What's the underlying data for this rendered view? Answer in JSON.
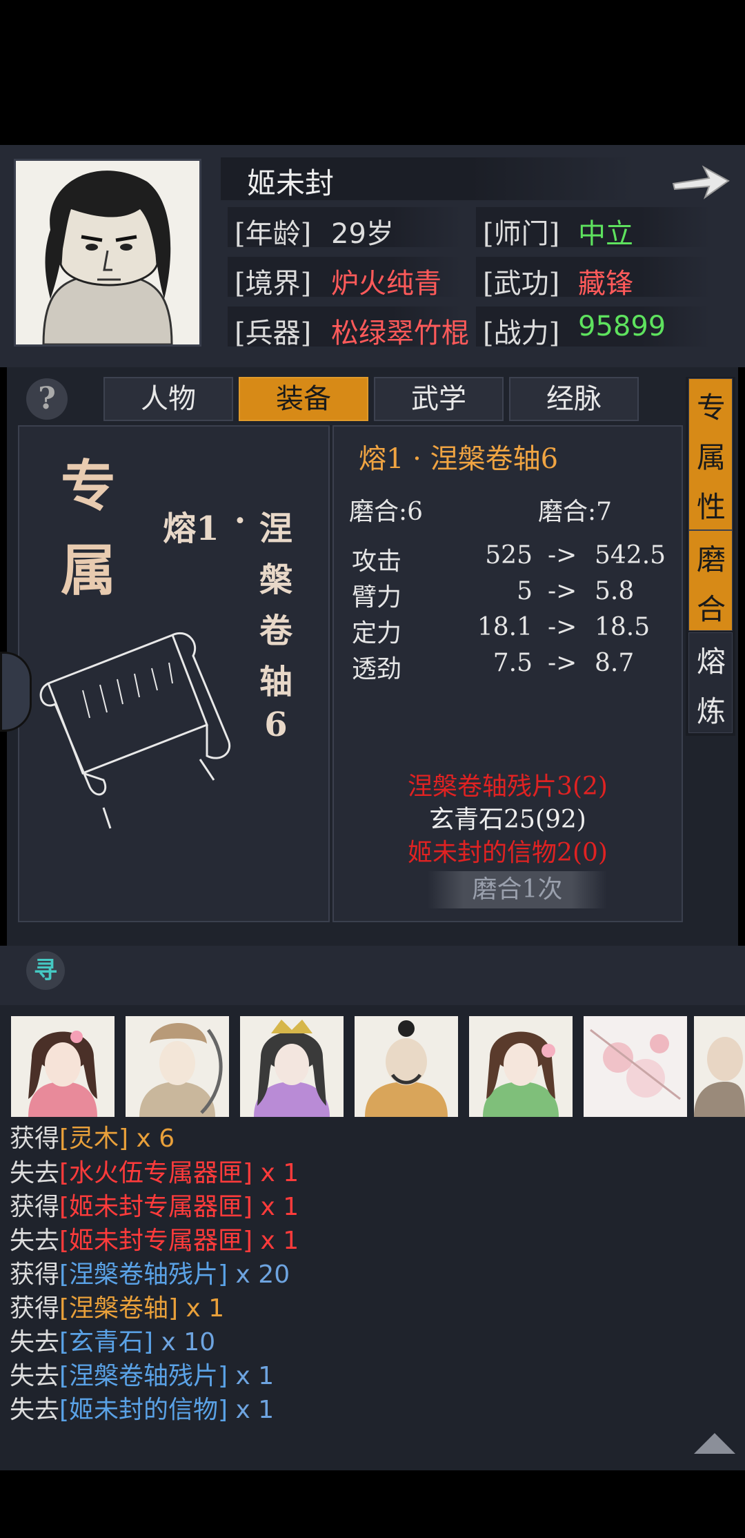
{
  "character": {
    "name": "姬未封",
    "rows": [
      {
        "label1": "[年龄]",
        "value1": "29岁",
        "color1": "#dddddd",
        "label2": "[师门]",
        "value2": "中立",
        "color2": "#5ee25e"
      },
      {
        "label1": "[境界]",
        "value1": "炉火纯青",
        "color1": "#ff5a5a",
        "label2": "[武功]",
        "value2": "藏锋",
        "color2": "#ff5a5a"
      },
      {
        "label1": "[兵器]",
        "value1": "松绿翠竹棍",
        "color1": "#ff5a5a",
        "label2": "[战力]",
        "value2": "95899",
        "color2": "#5ee25e"
      }
    ]
  },
  "help_icon": "?",
  "tabs": [
    "人物",
    "装备",
    "武学",
    "经脉"
  ],
  "side_tabs": [
    {
      "chars": [
        "专",
        "属",
        "性"
      ]
    },
    {
      "chars": [
        "磨",
        "合"
      ]
    },
    {
      "chars": [
        "熔",
        "炼"
      ]
    }
  ],
  "item": {
    "category_chars": [
      "专",
      "属"
    ],
    "vertical_name": [
      "熔1",
      "·",
      "涅",
      "槃",
      "卷",
      "轴",
      "6"
    ],
    "title": "熔1 · 涅槃卷轴6",
    "hone_current": "磨合:6",
    "hone_next": "磨合:7",
    "stats": [
      {
        "name": "攻击",
        "from": "525",
        "arrow": "->",
        "to": "542.5"
      },
      {
        "name": "臂力",
        "from": "5",
        "arrow": "->",
        "to": "5.8"
      },
      {
        "name": "定力",
        "from": "18.1",
        "arrow": "->",
        "to": "18.5"
      },
      {
        "name": "透劲",
        "from": "7.5",
        "arrow": "->",
        "to": "8.7"
      }
    ],
    "materials": [
      {
        "text": "涅槃卷轴残片3(2)",
        "color": "#e02222"
      },
      {
        "text": "玄青石25(92)",
        "color": "#eeeeee"
      },
      {
        "text": "姬未封的信物2(0)",
        "color": "#e02222"
      }
    ],
    "hone_button": "磨合1次"
  },
  "search_icon": "寻",
  "log": [
    {
      "verb": "获得",
      "item": "[灵木]",
      "qty": " x 6",
      "color": "#e9a03a"
    },
    {
      "verb": "失去",
      "item": "[水火伍专属器匣]",
      "qty": " x 1",
      "color": "#ff3b3b"
    },
    {
      "verb": "获得",
      "item": "[姬未封专属器匣]",
      "qty": " x 1",
      "color": "#ff3b3b"
    },
    {
      "verb": "失去",
      "item": "[姬未封专属器匣]",
      "qty": " x 1",
      "color": "#ff3b3b"
    },
    {
      "verb": "获得",
      "item": "[涅槃卷轴残片]",
      "qty": " x 20",
      "color": "#5aa2e6"
    },
    {
      "verb": "获得",
      "item": "[涅槃卷轴]",
      "qty": " x 1",
      "color": "#e9a03a"
    },
    {
      "verb": "失去",
      "item": "[玄青石]",
      "qty": " x 10",
      "color": "#5aa2e6"
    },
    {
      "verb": "失去",
      "item": "[涅槃卷轴残片]",
      "qty": " x 1",
      "color": "#5aa2e6"
    },
    {
      "verb": "失去",
      "item": "[姬未封的信物]",
      "qty": " x 1",
      "color": "#5aa2e6"
    }
  ]
}
